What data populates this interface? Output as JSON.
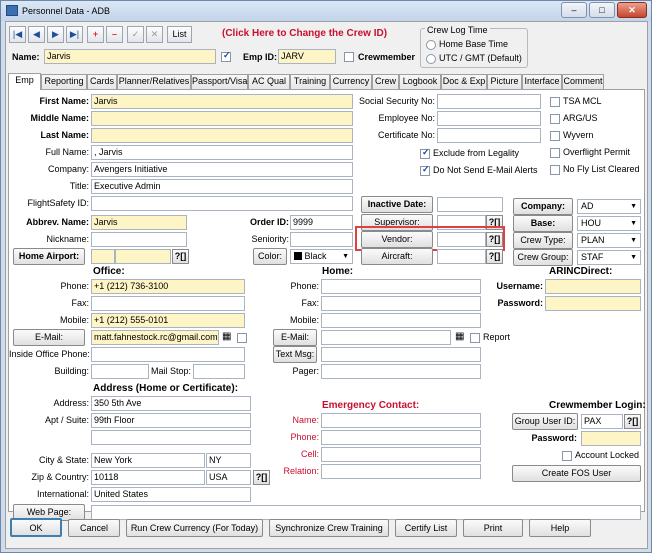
{
  "window": {
    "title": "Personnel Data - ADB",
    "min": "–",
    "max": "□",
    "close": "✕"
  },
  "toolbar": {
    "first": "|◀",
    "prev": "◀",
    "next": "▶",
    "last": "▶|",
    "add": "+",
    "remove": "–",
    "ok": "✓",
    "cancel": "✕",
    "list": "List",
    "change_crew": "(Click Here to Change the Crew ID)"
  },
  "header": {
    "name_label": "Name:",
    "name_value": "Jarvis",
    "emp_id_label": "Emp ID:",
    "emp_id_value": "JARV",
    "crewmember_label": "Crewmember"
  },
  "crew_log_time": {
    "title": "Crew Log Time",
    "home": "Home Base Time",
    "utc": "UTC / GMT (Default)"
  },
  "tabs": [
    "Emp",
    "Reporting",
    "Cards",
    "Planner/Relatives",
    "Passport/Visa",
    "AC Qual",
    "Training",
    "Currency",
    "Crew",
    "Logbook",
    "Doc & Exp",
    "Picture",
    "Interface",
    "Comment"
  ],
  "emp": {
    "first_name_label": "First Name:",
    "first_name": "Jarvis",
    "middle_name_label": "Middle Name:",
    "middle_name": "",
    "last_name_label": "Last Name:",
    "last_name": "",
    "full_name_label": "Full Name:",
    "full_name": ", Jarvis",
    "company_label": "Company:",
    "company": "Avengers Initiative",
    "title_label": "Title:",
    "title": "Executive Admin",
    "flightsafety_label": "FlightSafety ID:",
    "flightsafety": "",
    "abbrev_label": "Abbrev. Name:",
    "abbrev": "Jarvis",
    "nickname_label": "Nickname:",
    "nickname": "",
    "home_airport_btn": "Home Airport:",
    "order_id_label": "Order ID:",
    "order_id": "9999",
    "seniority_label": "Seniority:",
    "seniority": "",
    "color_btn": "Color:",
    "color_value": "Black",
    "ssn_label": "Social Security No:",
    "employee_no_label": "Employee No:",
    "certificate_no_label": "Certificate No:",
    "exclude_legality": "Exclude from Legality",
    "no_email_alerts": "Do Not Send E-Mail Alerts",
    "inactive_date_btn": "Inactive Date:",
    "supervisor_btn": "Supervisor:",
    "vendor_btn": "Vendor:",
    "aircraft_btn": "Aircraft:",
    "tsa_mcl": "TSA MCL",
    "arg_us": "ARG/US",
    "wyvern": "Wyvern",
    "overflight": "Overflight Permit",
    "no_fly": "No Fly List Cleared",
    "company_btn": "Company:",
    "company_val": "AD",
    "base_btn": "Base:",
    "base_val": "HOU",
    "crew_type_btn": "Crew Type:",
    "crew_type_val": "PLAN",
    "crew_group_btn": "Crew Group:",
    "crew_group_val": "STAF",
    "q": "?[]"
  },
  "office": {
    "title": "Office:",
    "phone_label": "Phone:",
    "phone": "+1 (212) 736-3100",
    "fax_label": "Fax:",
    "fax": "",
    "mobile_label": "Mobile:",
    "mobile": "+1 (212) 555-0101",
    "email_btn": "E-Mail:",
    "email": "matt.fahnestock.rc@gmail.com",
    "inside_phone_label": "Inside Office Phone:",
    "building_label": "Building:",
    "mail_stop_label": "Mail Stop:"
  },
  "home": {
    "title": "Home:",
    "phone_label": "Phone:",
    "fax_label": "Fax:",
    "mobile_label": "Mobile:",
    "email_btn": "E-Mail:",
    "report_label": "Report",
    "text_msg_btn": "Text Msg:",
    "pager_label": "Pager:"
  },
  "arinc": {
    "title": "ARINCDirect:",
    "username_label": "Username:",
    "password_label": "Password:"
  },
  "address": {
    "title": "Address (Home or Certificate):",
    "address_label": "Address:",
    "address": "350 5th Ave",
    "apt_label": "Apt / Suite:",
    "apt": "99th Floor",
    "city_label": "City & State:",
    "city": "New York",
    "state": "NY",
    "zip_label": "Zip & Country:",
    "zip": "10118",
    "country": "USA",
    "intl_label": "International:",
    "intl": "United States",
    "web_btn": "Web Page:"
  },
  "emergency": {
    "title": "Emergency Contact:",
    "name_label": "Name:",
    "phone_label": "Phone:",
    "cell_label": "Cell:",
    "relation_label": "Relation:"
  },
  "login": {
    "title": "Crewmember Login:",
    "group_user_btn": "Group User ID:",
    "group_user": "PAX",
    "password_label": "Password:",
    "locked_label": "Account Locked",
    "create_fos_btn": "Create FOS User"
  },
  "footer": {
    "ok": "OK",
    "cancel": "Cancel",
    "run_currency": "Run Crew Currency (For Today)",
    "sync_training": "Synchronize Crew Training",
    "certify_list": "Certify List",
    "print": "Print",
    "help": "Help"
  }
}
